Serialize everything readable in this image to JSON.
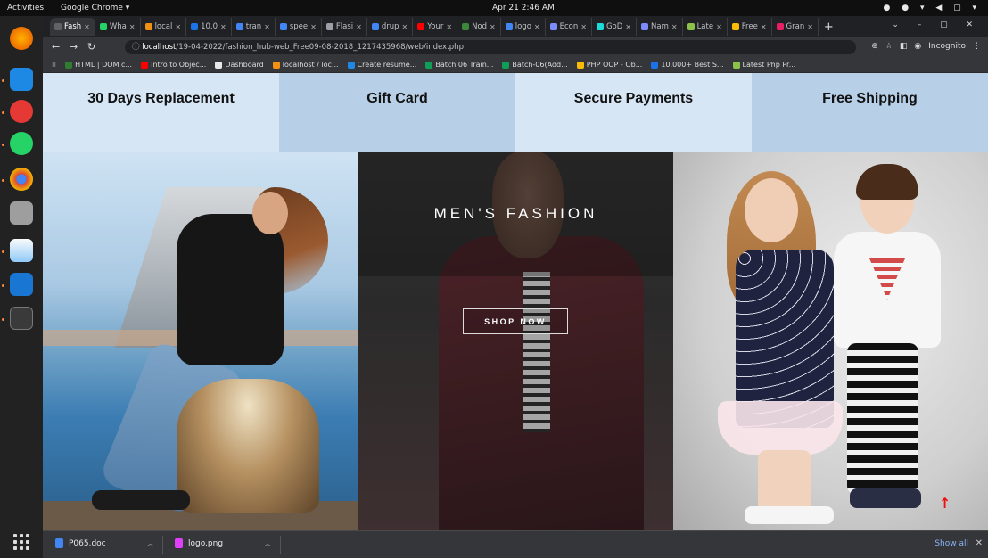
{
  "topbar": {
    "activities": "Activities",
    "app_name": "Google Chrome ▾",
    "clock": "Apr 21  2:46 AM"
  },
  "tabs": [
    {
      "label": "Fash",
      "color": "#5f6368",
      "active": true
    },
    {
      "label": "Wha",
      "color": "#25d366"
    },
    {
      "label": "local",
      "color": "#f29111"
    },
    {
      "label": "10,0",
      "color": "#1a73e8"
    },
    {
      "label": "tran",
      "color": "#4285f4"
    },
    {
      "label": "spee",
      "color": "#4285f4"
    },
    {
      "label": "Flasi",
      "color": "#9aa0a6"
    },
    {
      "label": "drup",
      "color": "#4285f4"
    },
    {
      "label": "Your",
      "color": "#ff0000"
    },
    {
      "label": "Nod",
      "color": "#3c873a"
    },
    {
      "label": "logo",
      "color": "#4285f4"
    },
    {
      "label": "Econ",
      "color": "#7c8cff"
    },
    {
      "label": "GoD",
      "color": "#1bdbdb"
    },
    {
      "label": "Nam",
      "color": "#7c8cff"
    },
    {
      "label": "Late",
      "color": "#8bc34a"
    },
    {
      "label": "Free",
      "color": "#fbbc05"
    },
    {
      "label": "Gran",
      "color": "#e91e63"
    }
  ],
  "omnibox": {
    "host": "localhost",
    "path": "/19-04-2022/fashion_hub-web_Free09-08-2018_1217435968/web/index.php",
    "incognito": "Incognito"
  },
  "bookmarks": [
    {
      "label": "HTML | DOM c...",
      "color": "#2e7d32"
    },
    {
      "label": "Intro to Objec...",
      "color": "#ff0000"
    },
    {
      "label": "Dashboard",
      "color": "#e8e8e8"
    },
    {
      "label": "localhost / loc...",
      "color": "#f29111"
    },
    {
      "label": "Create resume...",
      "color": "#1e88e5"
    },
    {
      "label": "Batch 06 Train...",
      "color": "#0f9d58"
    },
    {
      "label": "Batch-06(Add...",
      "color": "#0f9d58"
    },
    {
      "label": "PHP OOP - Ob...",
      "color": "#fbbc05"
    },
    {
      "label": "10,000+ Best S...",
      "color": "#1a73e8"
    },
    {
      "label": "Latest Php Pr...",
      "color": "#8bc34a"
    }
  ],
  "features": [
    "30 Days Replacement",
    "Gift Card",
    "Secure Payments",
    "Free Shipping"
  ],
  "banner_men": {
    "title": "MEN'S FASHION",
    "button": "SHOP NOW"
  },
  "downloads": {
    "items": [
      {
        "name": "P065.doc",
        "color": "#4285f4"
      },
      {
        "name": "logo.png",
        "color": "#e040fb"
      }
    ],
    "show_all": "Show all"
  }
}
